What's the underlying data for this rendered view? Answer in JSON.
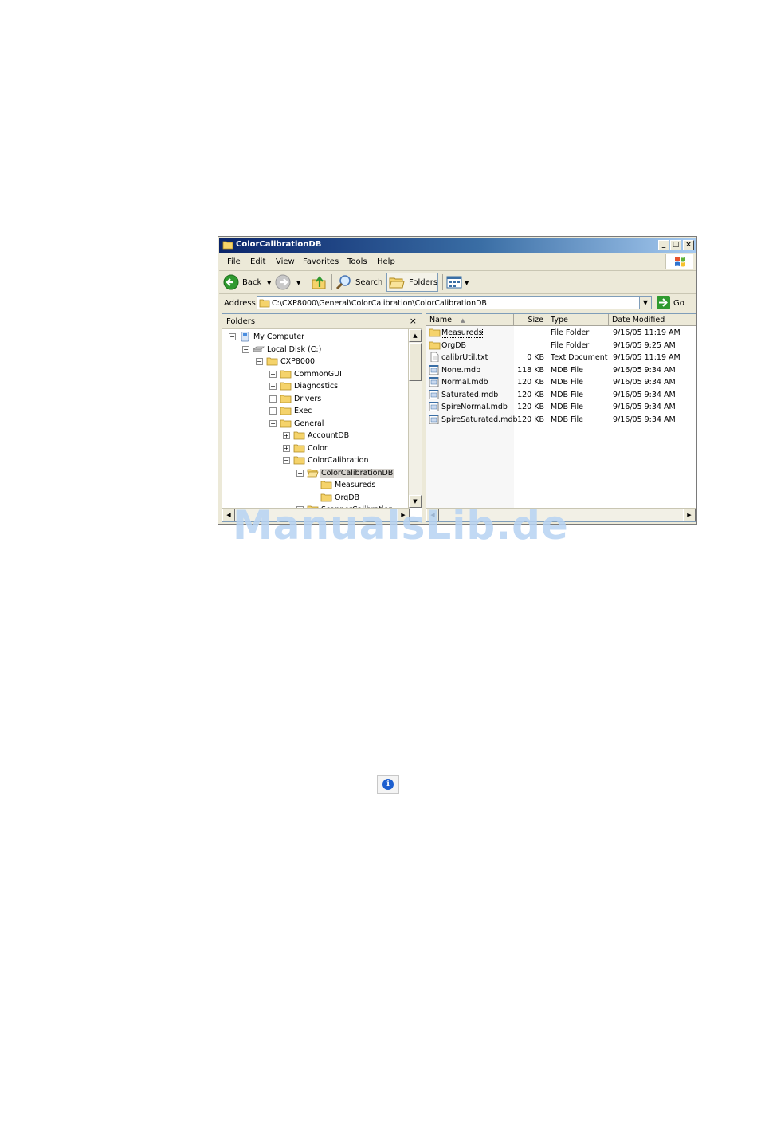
{
  "window": {
    "title": "ColorCalibrationDB",
    "buttons": {
      "minimize": "_",
      "maximize": "□",
      "close": "×"
    }
  },
  "menu": [
    {
      "key": "F",
      "rest": "ile"
    },
    {
      "key": "E",
      "rest": "dit"
    },
    {
      "key": "V",
      "rest": "iew"
    },
    {
      "key": "F",
      "rest": "avorites",
      "pre": ""
    },
    {
      "key": "T",
      "rest": "ools"
    },
    {
      "key": "H",
      "rest": "elp"
    }
  ],
  "menu_labels": [
    "File",
    "Edit",
    "View",
    "Favorites",
    "Tools",
    "Help"
  ],
  "toolbar": {
    "back_label": "Back",
    "search_label": "Search",
    "folders_label": "Folders"
  },
  "address": {
    "label": "Address",
    "path": "C:\\CXP8000\\General\\ColorCalibration\\ColorCalibrationDB",
    "go_label": "Go"
  },
  "folders_pane": {
    "title": "Folders",
    "close": "×",
    "tree": [
      {
        "label": "My Computer",
        "depth": 0,
        "exp": "−",
        "icon": "computer-icon"
      },
      {
        "label": "Local Disk (C:)",
        "depth": 1,
        "exp": "−",
        "icon": "drive-icon"
      },
      {
        "label": "CXP8000",
        "depth": 2,
        "exp": "−",
        "icon": "folder-icon"
      },
      {
        "label": "CommonGUI",
        "depth": 3,
        "exp": "+",
        "icon": "folder-icon"
      },
      {
        "label": "Diagnostics",
        "depth": 3,
        "exp": "+",
        "icon": "folder-icon"
      },
      {
        "label": "Drivers",
        "depth": 3,
        "exp": "+",
        "icon": "folder-icon"
      },
      {
        "label": "Exec",
        "depth": 3,
        "exp": "+",
        "icon": "folder-icon"
      },
      {
        "label": "General",
        "depth": 3,
        "exp": "−",
        "icon": "folder-icon"
      },
      {
        "label": "AccountDB",
        "depth": 4,
        "exp": "+",
        "icon": "folder-icon"
      },
      {
        "label": "Color",
        "depth": 4,
        "exp": "+",
        "icon": "folder-icon"
      },
      {
        "label": "ColorCalibration",
        "depth": 4,
        "exp": "−",
        "icon": "folder-icon"
      },
      {
        "label": "ColorCalibrationDB",
        "depth": 5,
        "exp": "−",
        "icon": "open-folder-icon",
        "selected": true
      },
      {
        "label": "Measureds",
        "depth": 6,
        "exp": "",
        "icon": "folder-icon"
      },
      {
        "label": "OrgDB",
        "depth": 6,
        "exp": "",
        "icon": "folder-icon"
      },
      {
        "label": "ScannerCalibration",
        "depth": 5,
        "exp": "+",
        "icon": "folder-icon"
      }
    ]
  },
  "files": {
    "columns": [
      "Name",
      "Size",
      "Type",
      "Date Modified"
    ],
    "rows": [
      {
        "name": "Measureds",
        "size": "",
        "type": "File Folder",
        "date": "9/16/05 11:19 AM",
        "icon": "folder-icon"
      },
      {
        "name": "OrgDB",
        "size": "",
        "type": "File Folder",
        "date": "9/16/05 9:25 AM",
        "icon": "folder-icon"
      },
      {
        "name": "calibrUtil.txt",
        "size": "0 KB",
        "type": "Text Document",
        "date": "9/16/05 11:19 AM",
        "icon": "text-file-icon"
      },
      {
        "name": "None.mdb",
        "size": "118 KB",
        "type": "MDB File",
        "date": "9/16/05 9:34 AM",
        "icon": "mdb-file-icon"
      },
      {
        "name": "Normal.mdb",
        "size": "120 KB",
        "type": "MDB File",
        "date": "9/16/05 9:34 AM",
        "icon": "mdb-file-icon"
      },
      {
        "name": "Saturated.mdb",
        "size": "120 KB",
        "type": "MDB File",
        "date": "9/16/05 9:34 AM",
        "icon": "mdb-file-icon"
      },
      {
        "name": "SpireNormal.mdb",
        "size": "120 KB",
        "type": "MDB File",
        "date": "9/16/05 9:34 AM",
        "icon": "mdb-file-icon"
      },
      {
        "name": "SpireSaturated.mdb",
        "size": "120 KB",
        "type": "MDB File",
        "date": "9/16/05 9:34 AM",
        "icon": "mdb-file-icon"
      }
    ]
  },
  "watermark": "ManualsLib.de",
  "info_icon": "i",
  "colors": {
    "titlebar": "#0a246a",
    "chrome": "#ece9d8",
    "folder": "#f5d36b",
    "watermark": "#b7d3f3"
  }
}
